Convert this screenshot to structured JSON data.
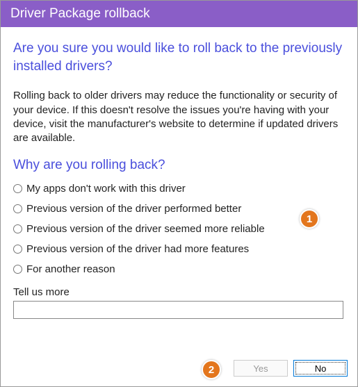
{
  "titlebar": "Driver Package rollback",
  "heading": "Are you sure you would like to roll back to the previously installed drivers?",
  "body": "Rolling back to older drivers may reduce the functionality or security of your device.  If this doesn't resolve the issues you're having with your device, visit the manufacturer's website to determine if updated drivers are available.",
  "subheading": "Why are you rolling back?",
  "reasons": [
    "My apps don't work with this driver",
    "Previous version of the driver performed better",
    "Previous version of the driver seemed more reliable",
    "Previous version of the driver had more features",
    "For another reason"
  ],
  "tellus_label": "Tell us more",
  "tellus_value": "",
  "buttons": {
    "yes": "Yes",
    "no": "No"
  },
  "callouts": {
    "one": "1",
    "two": "2"
  }
}
